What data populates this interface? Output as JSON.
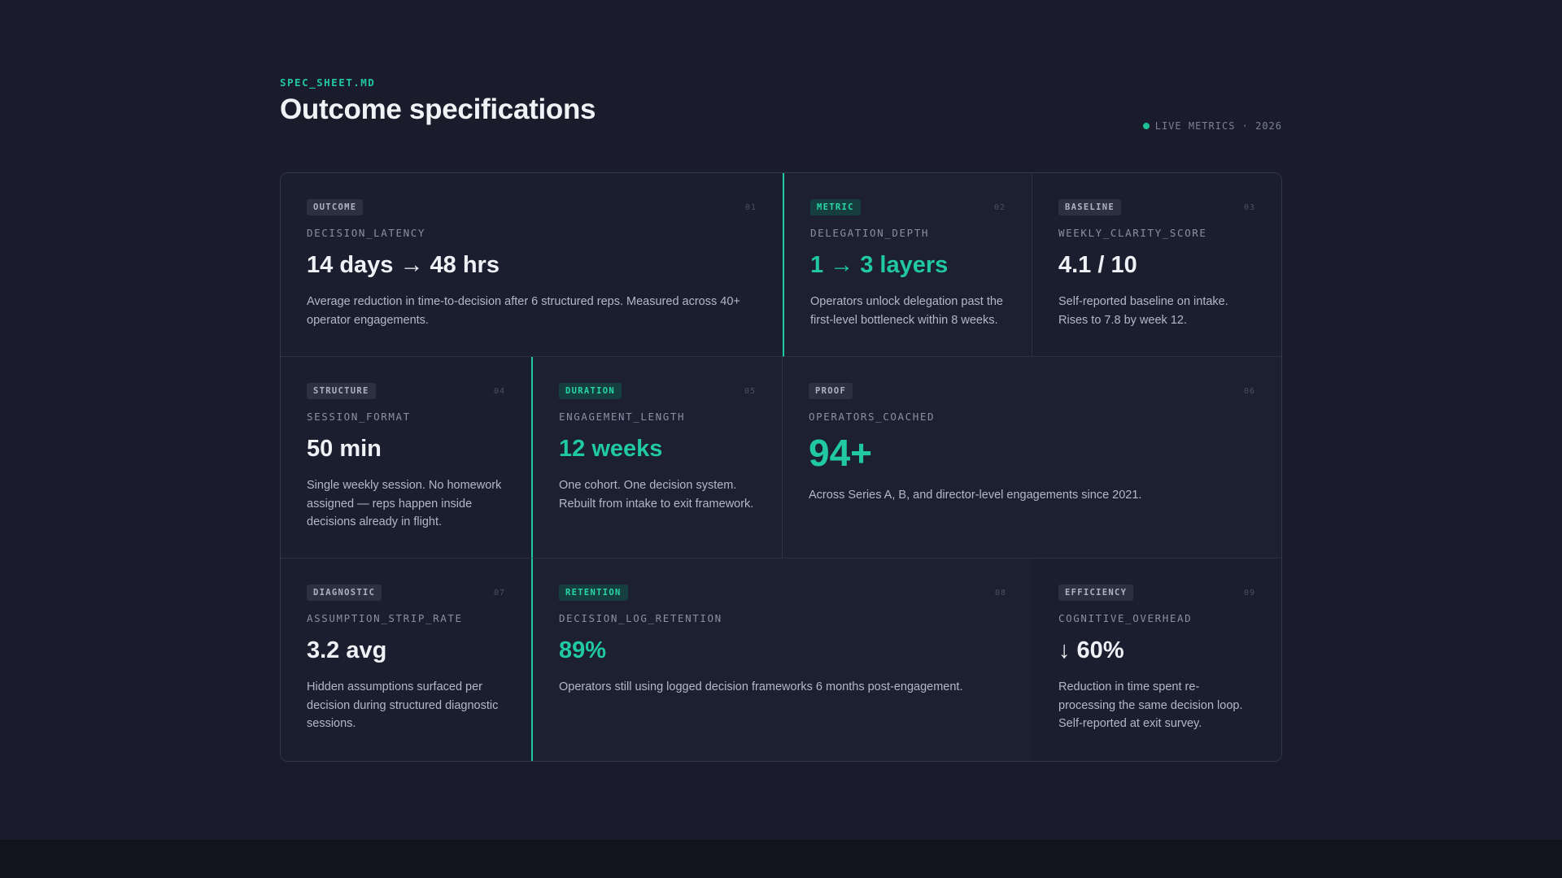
{
  "header": {
    "file_label": "SPEC_SHEET.MD",
    "title": "Outcome specifications",
    "live_label": "LIVE METRICS · 2026"
  },
  "cards": [
    {
      "badge": "OUTCOME",
      "num": "01",
      "key": "DECISION_LATENCY",
      "value": "14 days → 48 hrs",
      "desc": "Average reduction in time-to-decision after 6 structured reps. Measured across 40+ operator engagements."
    },
    {
      "badge": "METRIC",
      "num": "02",
      "key": "DELEGATION_DEPTH",
      "value": "1 → 3 layers",
      "desc": "Operators unlock delegation past the first-level bottleneck within 8 weeks."
    },
    {
      "badge": "BASELINE",
      "num": "03",
      "key": "WEEKLY_CLARITY_SCORE",
      "value": "4.1 / 10",
      "desc": "Self-reported baseline on intake. Rises to 7.8 by week 12."
    },
    {
      "badge": "STRUCTURE",
      "num": "04",
      "key": "SESSION_FORMAT",
      "value": "50 min",
      "desc": "Single weekly session. No homework assigned — reps happen inside decisions already in flight."
    },
    {
      "badge": "DURATION",
      "num": "05",
      "key": "ENGAGEMENT_LENGTH",
      "value": "12 weeks",
      "desc": "One cohort. One decision system. Rebuilt from intake to exit framework."
    },
    {
      "badge": "PROOF",
      "num": "06",
      "key": "OPERATORS_COACHED",
      "value": "94+",
      "desc": "Across Series A, B, and director-level engagements since 2021."
    },
    {
      "badge": "DIAGNOSTIC",
      "num": "07",
      "key": "ASSUMPTION_STRIP_RATE",
      "value": "3.2 avg",
      "desc": "Hidden assumptions surfaced per decision during structured diagnostic sessions."
    },
    {
      "badge": "RETENTION",
      "num": "08",
      "key": "DECISION_LOG_RETENTION",
      "value": "89%",
      "desc": "Operators still using logged decision frameworks 6 months post-engagement."
    },
    {
      "badge": "EFFICIENCY",
      "num": "09",
      "key": "COGNITIVE_OVERHEAD",
      "value": "↓ 60%",
      "desc": "Reduction in time spent re-processing the same decision loop. Self-reported at exit survey."
    }
  ]
}
